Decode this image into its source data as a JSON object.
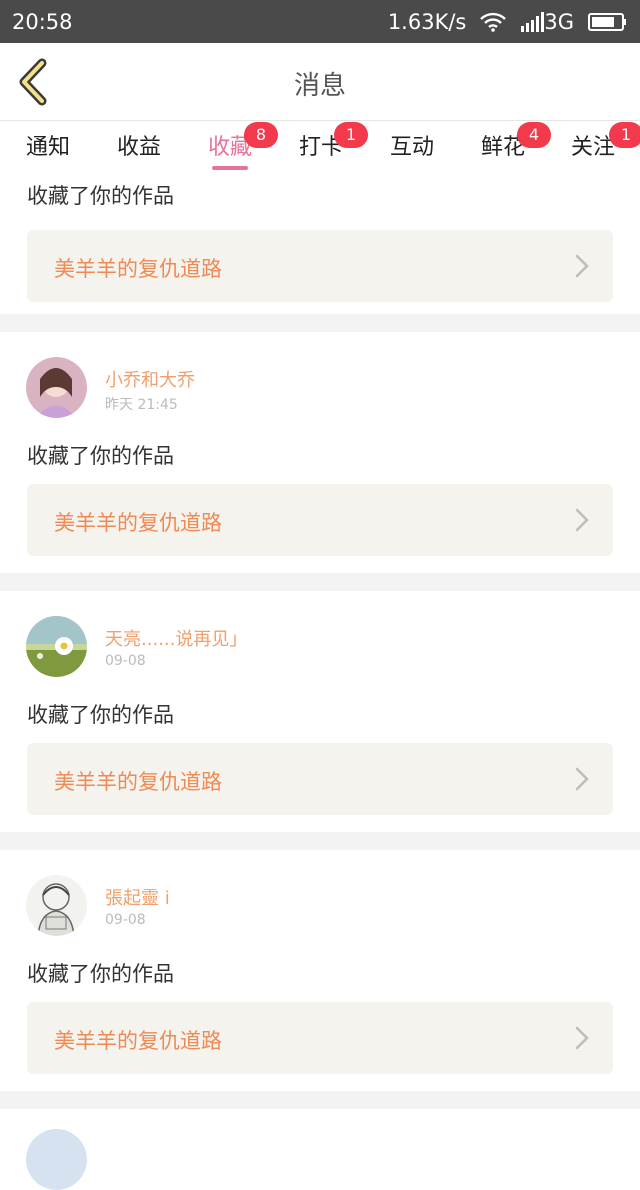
{
  "status_bar": {
    "time": "20:58",
    "speed": "1.63K/s",
    "network": "3G"
  },
  "nav": {
    "title": "消息"
  },
  "tabs": [
    {
      "label": "通知"
    },
    {
      "label": "收益"
    },
    {
      "label": "收藏",
      "badge": "8",
      "active": true
    },
    {
      "label": "打卡",
      "badge": "1"
    },
    {
      "label": "互动"
    },
    {
      "label": "鲜花",
      "badge": "4"
    },
    {
      "label": "关注",
      "badge": "1"
    }
  ],
  "feed": {
    "partial_top": {
      "action": "收藏了你的作品",
      "work": "美羊羊的复仇道路"
    },
    "items": [
      {
        "username": "小乔和大乔",
        "time": "昨天 21:45",
        "action": "收藏了你的作品",
        "work": "美羊羊的复仇道路"
      },
      {
        "username": "天亮......说再见」",
        "time": "09-08",
        "action": "收藏了你的作品",
        "work": "美羊羊的复仇道路"
      },
      {
        "username": "張起靈 i",
        "time": "09-08",
        "action": "收藏了你的作品",
        "work": "美羊羊的复仇道路"
      }
    ]
  },
  "colors": {
    "accent": "#e6739a",
    "badge": "#f23a4c",
    "username": "#f0a06c",
    "work_title": "#f08a55",
    "work_bg": "#f4f3ed"
  }
}
